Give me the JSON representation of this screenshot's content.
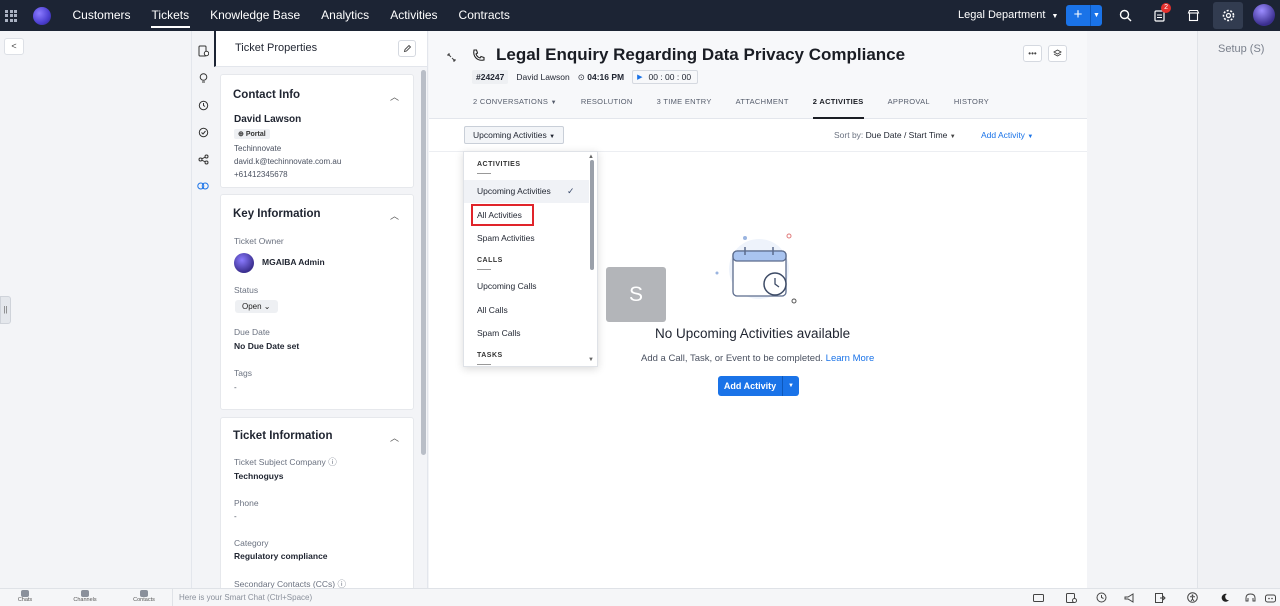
{
  "topnav": {
    "links": [
      "Customers",
      "Tickets",
      "Knowledge Base",
      "Analytics",
      "Activities",
      "Contracts"
    ],
    "active": "Tickets",
    "department": "Legal Department",
    "notification_count": "2"
  },
  "props": {
    "header": "Ticket Properties",
    "contact": {
      "title": "Contact Info",
      "name": "David Lawson",
      "badge": "Portal",
      "company": "Techinnovate",
      "email": "david.k@techinnovate.com.au",
      "phone": "+61412345678"
    },
    "key": {
      "title": "Key Information",
      "owner_label": "Ticket Owner",
      "owner": "MGAIBA Admin",
      "status_label": "Status",
      "status": "Open",
      "due_label": "Due Date",
      "due": "No Due Date set",
      "tags_label": "Tags",
      "tags": "-"
    },
    "info": {
      "title": "Ticket Information",
      "company_label": "Ticket Subject Company",
      "company": "Technoguys",
      "phone_label": "Phone",
      "phone": "-",
      "category_label": "Category",
      "category": "Regulatory compliance",
      "cc_label": "Secondary Contacts (CCs)"
    }
  },
  "ticket": {
    "title": "Legal Enquiry Regarding Data Privacy Compliance",
    "number": "#24247",
    "contact": "David Lawson",
    "time": "04:16 PM",
    "timer": "00 : 00 : 00",
    "tabs": [
      "2 CONVERSATIONS",
      "RESOLUTION",
      "3 TIME ENTRY",
      "ATTACHMENT",
      "2 ACTIVITIES",
      "APPROVAL",
      "HISTORY"
    ],
    "active_tab": "2 ACTIVITIES"
  },
  "filter": {
    "selected": "Upcoming Activities",
    "sort_label": "Sort by:",
    "sort_value": "Due Date / Start Time",
    "add_link": "Add Activity"
  },
  "dropdown": {
    "sections": [
      {
        "title": "ACTIVITIES",
        "items": [
          "Upcoming Activities",
          "All Activities",
          "Spam Activities"
        ]
      },
      {
        "title": "CALLS",
        "items": [
          "Upcoming Calls",
          "All Calls",
          "Spam Calls"
        ]
      },
      {
        "title": "TASKS",
        "items": []
      }
    ],
    "selected": "Upcoming Activities"
  },
  "empty": {
    "avatar_letter": "S",
    "title": "No Upcoming Activities available",
    "subtitle": "Add a Call, Task, or Event to be completed.",
    "learn_more": "Learn More",
    "button": "Add Activity"
  },
  "setup": "Setup (S)",
  "bottombar": {
    "items": [
      "Chats",
      "Channels",
      "Contacts"
    ],
    "smart_chat": "Here is your Smart Chat (Ctrl+Space)"
  }
}
